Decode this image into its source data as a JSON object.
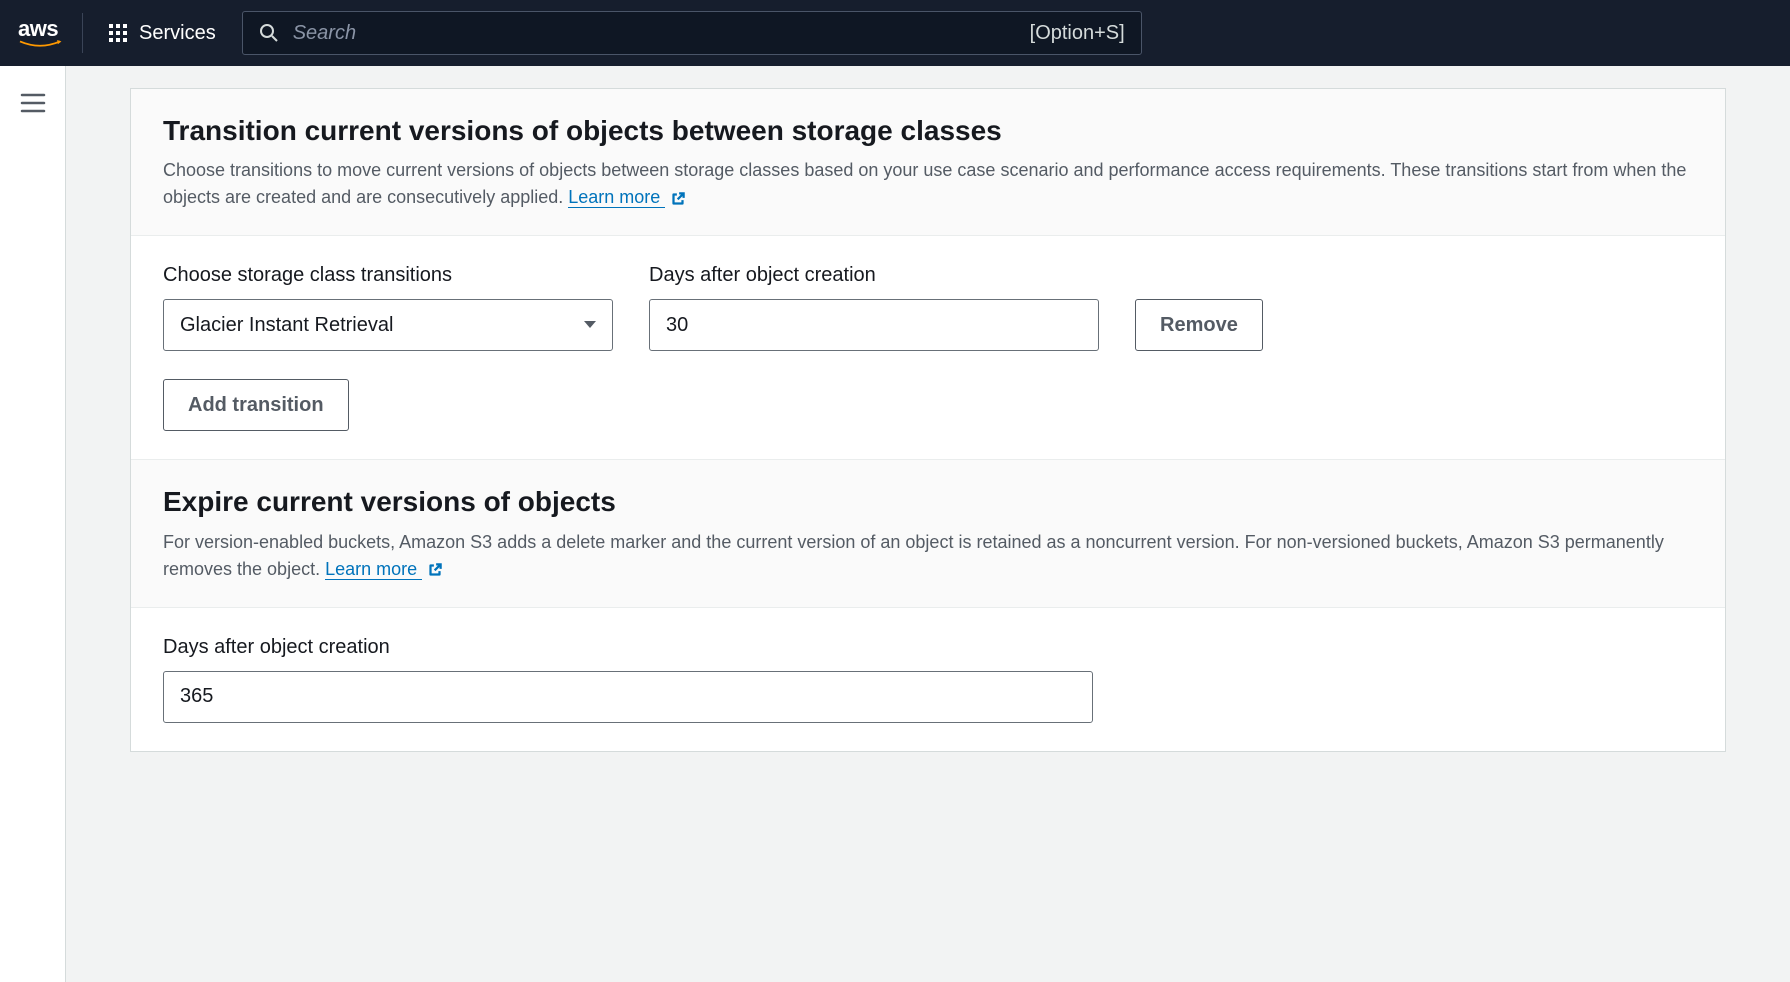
{
  "nav": {
    "services_label": "Services",
    "search_placeholder": "Search",
    "search_shortcut": "[Option+S]"
  },
  "section_transition": {
    "title": "Transition current versions of objects between storage classes",
    "description": "Choose transitions to move current versions of objects between storage classes based on your use case scenario and performance access requirements. These transitions start from when the objects are created and are consecutively applied. ",
    "learn_more_label": "Learn more ",
    "field_storage_label": "Choose storage class transitions",
    "field_days_label": "Days after object creation",
    "storage_value": "Glacier Instant Retrieval",
    "days_value": "30",
    "remove_btn": "Remove",
    "add_btn": "Add transition"
  },
  "section_expire": {
    "title": "Expire current versions of objects",
    "description": "For version-enabled buckets, Amazon S3 adds a delete marker and the current version of an object is retained as a noncurrent version. For non-versioned buckets, Amazon S3 permanently removes the object. ",
    "learn_more_label": "Learn more ",
    "field_days_label": "Days after object creation",
    "days_value": "365"
  }
}
